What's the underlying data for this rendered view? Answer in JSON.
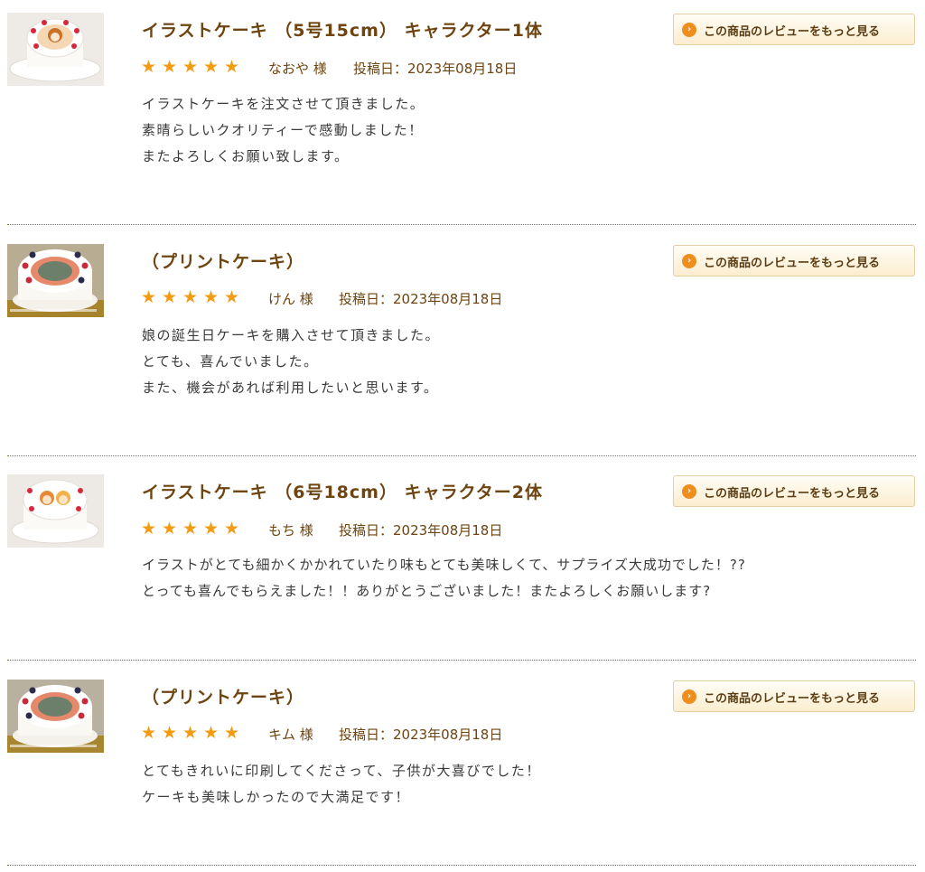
{
  "reviews": [
    {
      "title": "イラストケーキ （5号15cm） キャラクター1体",
      "button_label": "この商品のレビューをもっと見る",
      "button_icon": "chevron-right-icon",
      "rating": 5,
      "reviewer": "なおや 様",
      "posted": "投稿日：2023年08月18日",
      "lines": [
        "イラストケーキを注文させて頂きました。",
        "素晴らしいクオリティーで感動しました！",
        "またよろしくお願い致します。"
      ]
    },
    {
      "title": "（プリントケーキ）",
      "button_label": "この商品のレビューをもっと見る",
      "button_icon": "chevron-right-icon",
      "rating": 5,
      "reviewer": "けん 様",
      "posted": "投稿日：2023年08月18日",
      "lines": [
        "娘の誕生日ケーキを購入させて頂きました。",
        "とても、喜んでいました。",
        "また、機会があれば利用したいと思います。"
      ]
    },
    {
      "title": "イラストケーキ （6号18cm） キャラクター2体",
      "button_label": "この商品のレビューをもっと見る",
      "button_icon": "chevron-right-icon",
      "rating": 5,
      "reviewer": "もち 様",
      "posted": "投稿日：2023年08月18日",
      "lines": [
        "イラストがとても細かくかかれていたり味もとても美味しくて、サプライズ大成功でした！??",
        "とっても喜んでもらえました！！ありがとうございました！またよろしくお願いします?"
      ]
    },
    {
      "title": "（プリントケーキ）",
      "button_label": "この商品のレビューをもっと見る",
      "button_icon": "chevron-right-icon",
      "rating": 5,
      "reviewer": "キム 様",
      "posted": "投稿日：2023年08月18日",
      "lines": [
        "とてもきれいに印刷してくださって、子供が大喜びでした！",
        "ケーキも美味しかったので大満足です！"
      ]
    }
  ],
  "star_icon": "star-icon",
  "star_color": "#f39c12",
  "title_color": "#6e4410",
  "accent_color": "#ee8e1c"
}
